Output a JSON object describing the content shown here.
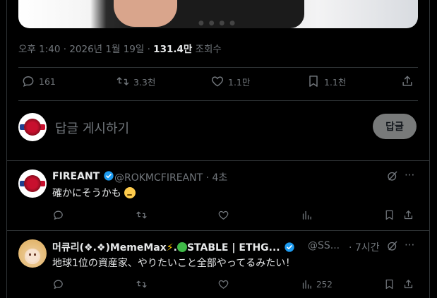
{
  "post": {
    "meta_time": "오후 1:40 · 2026년 1월 19일 · ",
    "meta_views": "131.4만",
    "meta_views_label": " 조회수",
    "stats": {
      "replies": "161",
      "reposts": "3.3천",
      "likes": "1.1만",
      "bookmarks": "1.1천"
    }
  },
  "reply_box": {
    "placeholder": "답글 게시하기",
    "button_label": "답글"
  },
  "replies": [
    {
      "name": "FIREANT",
      "handle": "@ROKMCFIREANT · 4초",
      "text": "確かにそうかも",
      "stats": {
        "views": ""
      }
    },
    {
      "name_part1": "머큐리(❖.❖)MemeMax",
      "name_part2": ".",
      "name_part3": "STABLE | ETHG...",
      "handle": "@SS...",
      "time": "· 7시간",
      "text": "地球1位の資産家、やりたいこと全部やってるみたい！",
      "stats": {
        "views": "252"
      }
    }
  ],
  "colors": {
    "background": "#000000",
    "text": "#e7e9ea",
    "muted": "#71767b",
    "border": "#2f3336",
    "verified": "#1d9bf0",
    "reply_button": "#787a7a"
  }
}
